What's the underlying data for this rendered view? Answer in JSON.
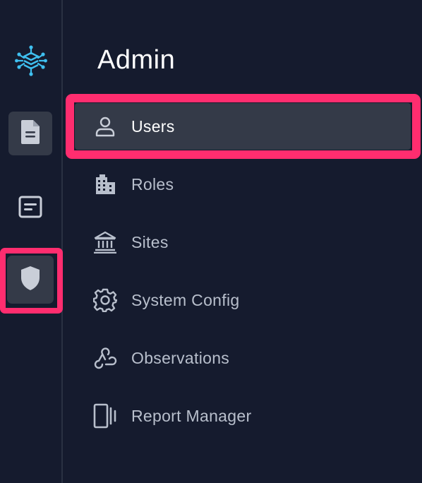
{
  "header": {
    "title": "Admin"
  },
  "rail": {
    "items": [
      {
        "name": "documents",
        "icon": "document-icon",
        "selected": false
      },
      {
        "name": "forms",
        "icon": "form-icon",
        "selected": false
      },
      {
        "name": "admin",
        "icon": "shield-icon",
        "selected": true
      }
    ],
    "logo_icon": "network-logo-icon"
  },
  "nav": {
    "items": [
      {
        "label": "Users",
        "icon": "user-icon",
        "active": true
      },
      {
        "label": "Roles",
        "icon": "building-icon",
        "active": false
      },
      {
        "label": "Sites",
        "icon": "institution-icon",
        "active": false
      },
      {
        "label": "System Config",
        "icon": "gear-icon",
        "active": false
      },
      {
        "label": "Observations",
        "icon": "webhook-icon",
        "active": false
      },
      {
        "label": "Report Manager",
        "icon": "report-panel-icon",
        "active": false
      }
    ]
  },
  "colors": {
    "background": "#151b2e",
    "active_item": "#343a48",
    "highlight": "#ff2d6f",
    "logo_accent": "#3fc0f0",
    "text_primary": "#ffffff",
    "text_secondary": "#b8bfcc"
  }
}
